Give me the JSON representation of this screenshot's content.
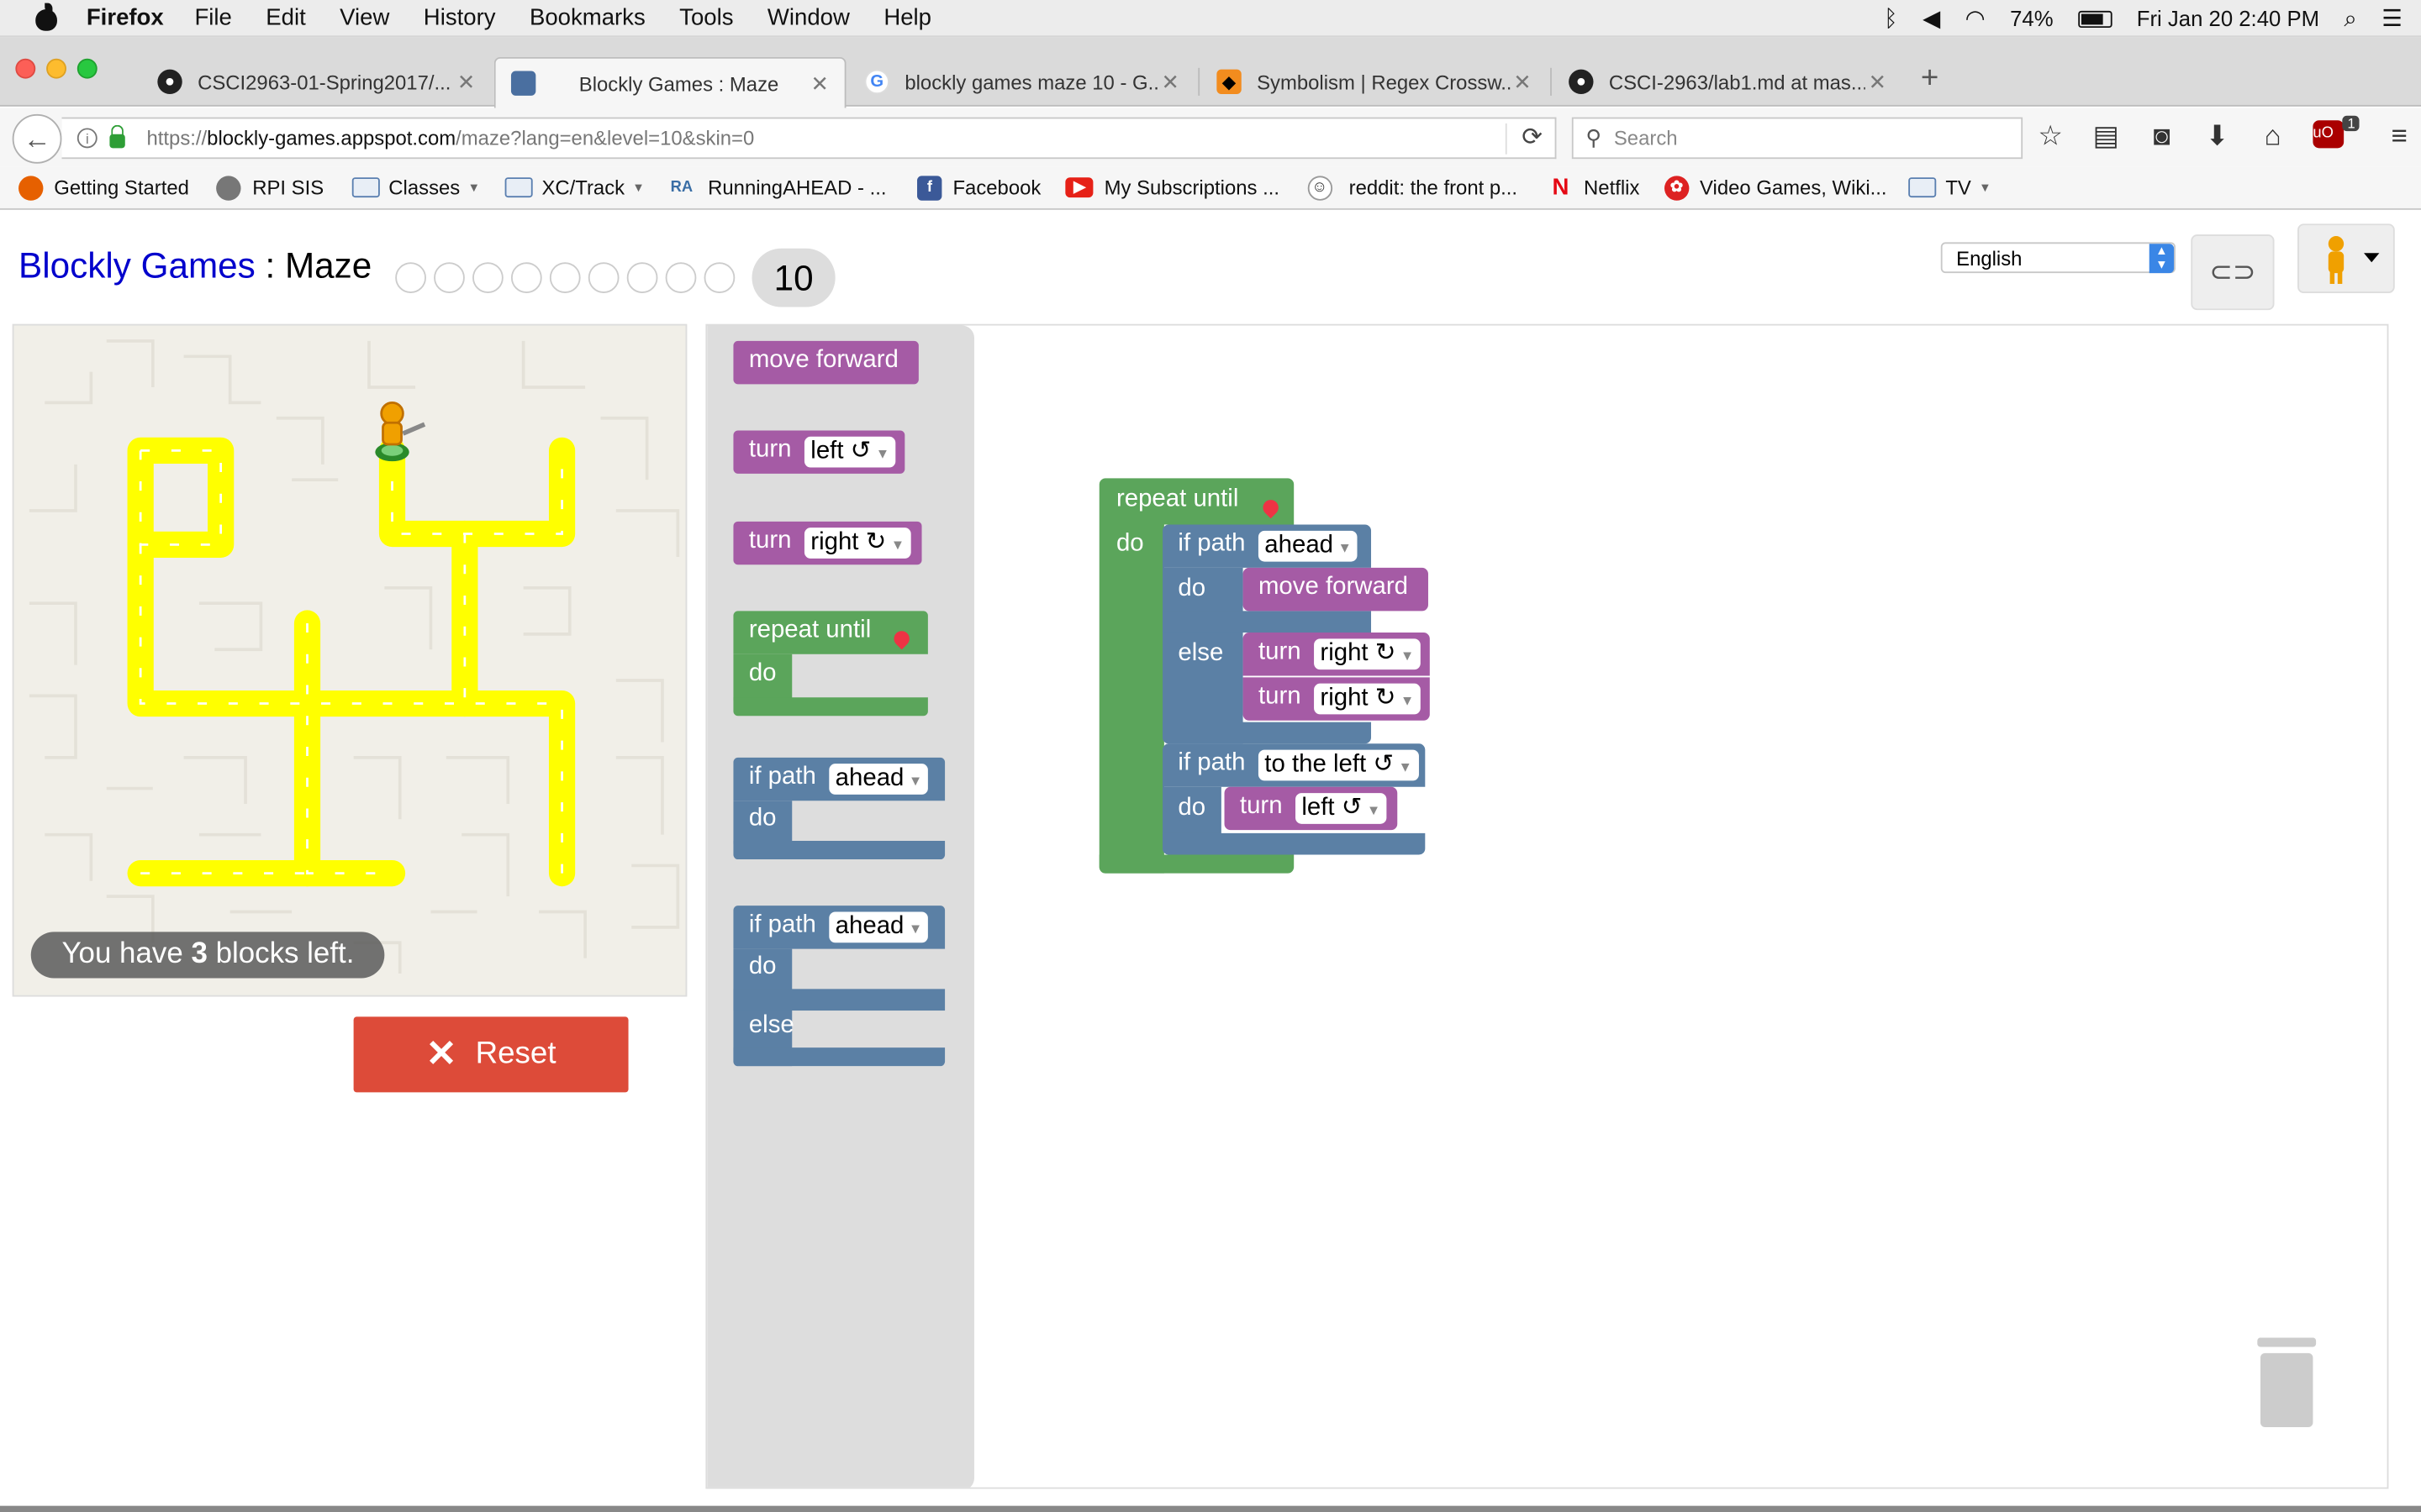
{
  "menubar": {
    "app": "Firefox",
    "items": [
      "File",
      "Edit",
      "View",
      "History",
      "Bookmarks",
      "Tools",
      "Window",
      "Help"
    ],
    "battery": "74%",
    "datetime": "Fri Jan 20  2:40 PM"
  },
  "tabs": [
    {
      "title": "CSCI2963-01-Spring2017/..."
    },
    {
      "title": "Blockly Games : Maze"
    },
    {
      "title": "blockly games maze 10 - G..."
    },
    {
      "title": "Symbolism | Regex Crossw..."
    },
    {
      "title": "CSCI-2963/lab1.md at mas..."
    }
  ],
  "navbar": {
    "url_prefix": "https://",
    "url_host": "blockly-games.appspot.com",
    "url_path": "/maze?lang=en&level=10&skin=0",
    "search_placeholder": "Search",
    "ublock_count": "1"
  },
  "bookmarks": [
    {
      "label": "Getting Started",
      "icon": "firefox-icon"
    },
    {
      "label": "RPI SIS",
      "icon": "globe-icon"
    },
    {
      "label": "Classes",
      "icon": "folder-icon"
    },
    {
      "label": "XC/Track",
      "icon": "folder-icon"
    },
    {
      "label": "RunningAHEAD - ...",
      "icon": "runningahead-icon"
    },
    {
      "label": "Facebook",
      "icon": "facebook-icon"
    },
    {
      "label": "My Subscriptions ...",
      "icon": "youtube-icon"
    },
    {
      "label": "reddit: the front p...",
      "icon": "reddit-icon"
    },
    {
      "label": "Netflix",
      "icon": "netflix-icon"
    },
    {
      "label": "Video Games, Wiki...",
      "icon": "wiki-icon"
    },
    {
      "label": "TV",
      "icon": "folder-icon"
    }
  ],
  "game": {
    "title_link": "Blockly Games",
    "separator": " : ",
    "title_rest": "Maze",
    "current_level": "10",
    "language": "English",
    "blocks_left_prefix": "You have ",
    "blocks_left_count": "3",
    "blocks_left_suffix": " blocks left.",
    "reset_label": "Reset"
  },
  "toolbox": {
    "move_forward": "move forward",
    "turn": "turn",
    "left": "left ↺",
    "right": "right ↻",
    "repeat_until": "repeat until",
    "do": "do",
    "else": "else",
    "if_path": "if path",
    "ahead": "ahead"
  },
  "program": {
    "repeat_until": "repeat until",
    "do": "do",
    "if_path": "if path",
    "ahead": "ahead",
    "move_forward": "move forward",
    "else": "else",
    "turn": "turn",
    "right": "right ↻",
    "to_the_left": "to the left ↺",
    "left": "left ↺"
  },
  "colors": {
    "motion": "#a55ba5",
    "loop": "#5ba55b",
    "logic": "#5b80a5",
    "path": "#ffff00",
    "reset": "#dd4b39",
    "title_link": "#0000cc"
  }
}
